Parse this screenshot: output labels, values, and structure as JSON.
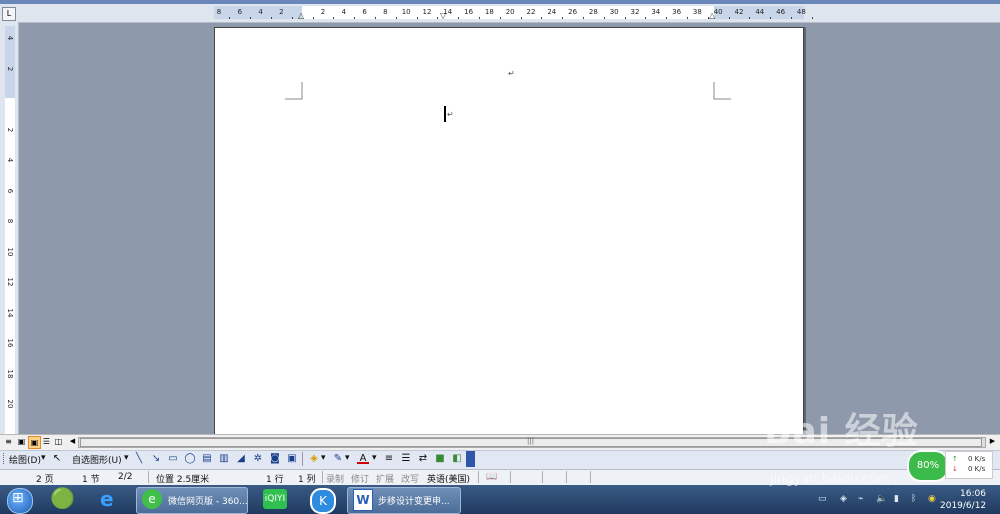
{
  "ruler": {
    "corner_label": "L",
    "h_labels": [
      "8",
      "6",
      "4",
      "2",
      "",
      "2",
      "4",
      "6",
      "8",
      "10",
      "12",
      "14",
      "16",
      "18",
      "20",
      "22",
      "24",
      "26",
      "28",
      "30",
      "32",
      "34",
      "36",
      "38",
      "40",
      "42",
      "44",
      "46",
      "48"
    ],
    "v_labels": [
      "4",
      "2",
      "",
      "2",
      "4",
      "6",
      "8",
      "10",
      "12",
      "14",
      "16",
      "18",
      "20"
    ]
  },
  "document": {
    "paragraph_mark": "↵"
  },
  "view_buttons": [
    "≡",
    "▣",
    "☰",
    "◫",
    "📖"
  ],
  "drawing_toolbar": {
    "draw_label": "绘图(D)",
    "autoshapes_label": "自选图形(U)",
    "icons": [
      "select-arrow",
      "line",
      "arrow",
      "rectangle",
      "oval",
      "text-box",
      "vertical-text-box",
      "wordart",
      "diagram",
      "clip-art",
      "picture",
      "fill-color",
      "line-color",
      "font-color",
      "line-style",
      "dash-style",
      "arrow-style",
      "shadow",
      "3d"
    ]
  },
  "status_bar": {
    "page": "2 页",
    "section": "1 节",
    "page_of": "2/2",
    "position": "位置 2.5厘米",
    "line": "1 行",
    "column": "1 列",
    "rec": "录制",
    "trk": "修订",
    "ext": "扩展",
    "ovr": "改写",
    "language": "英语(美国)"
  },
  "taskbar": {
    "items": [
      {
        "label": "微信网页版 - 360...",
        "icon": "360-browser-icon"
      },
      {
        "label": "",
        "icon": "iqiyi-icon"
      },
      {
        "label": "",
        "icon": "k-app-icon"
      },
      {
        "label": "步移设计变更申...",
        "icon": "word-icon"
      }
    ],
    "clock_time": "16:06",
    "clock_date": "2019/6/12"
  },
  "network_widget": {
    "percent": "80%",
    "upload": "0 K/s",
    "download": "0 K/s"
  },
  "watermark": {
    "logo": "Bai 经验",
    "url": "jingyan.baidu.com"
  }
}
